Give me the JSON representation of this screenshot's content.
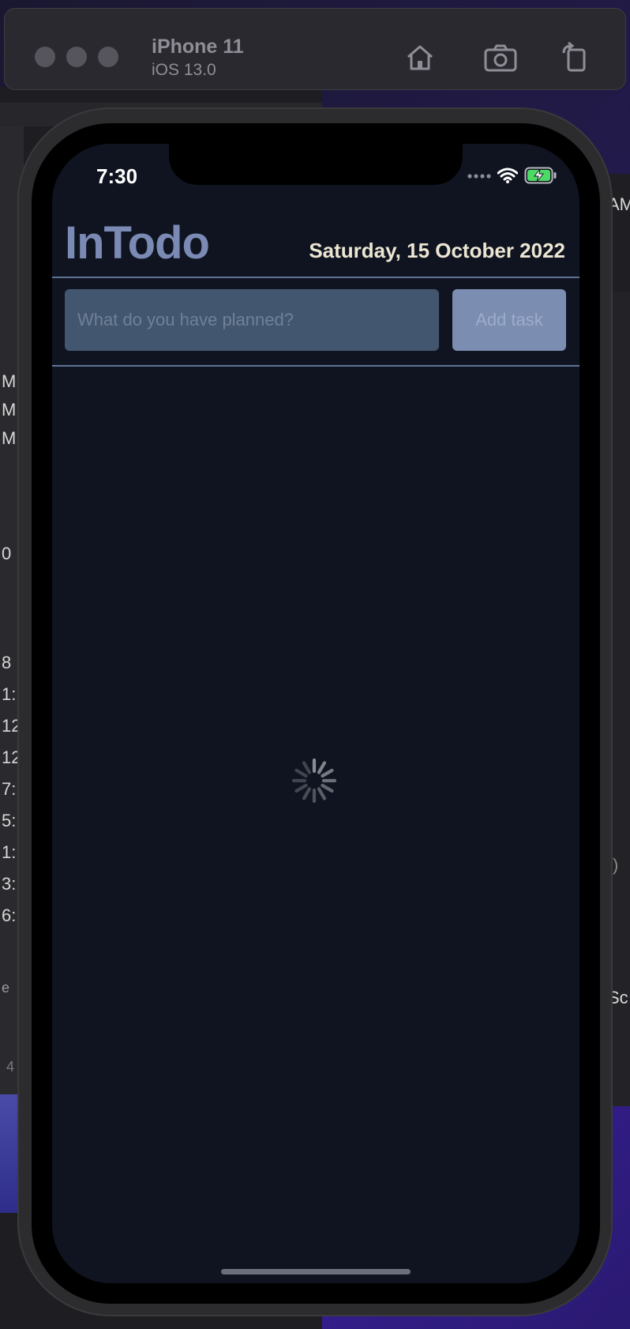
{
  "simulator": {
    "device_name": "iPhone 11",
    "os_version": "iOS 13.0",
    "buttons": [
      "home-icon",
      "screenshot-icon",
      "rotate-icon"
    ]
  },
  "status_bar": {
    "time": "7:30"
  },
  "app": {
    "title": "InTodo",
    "date": "Saturday, 15 October 2022",
    "input": {
      "value": "",
      "placeholder": "What do you have planned?"
    },
    "add_button_label": "Add task",
    "loading": true
  },
  "background": {
    "left_glyphs": [
      "M",
      "M",
      "M",
      "0",
      "8",
      "1:",
      "12",
      "12",
      "7:",
      "5:",
      "1:",
      "3:",
      "6:",
      "e",
      "4"
    ],
    "right_glyphs": [
      "AM",
      ")",
      "Sc"
    ]
  },
  "colors": {
    "screen_bg": "#0f1420",
    "title": "#7a8ab4",
    "date": "#ece6d2",
    "input_bg": "#43566f",
    "button_bg": "#7c8db2",
    "divider": "#5f7494"
  }
}
